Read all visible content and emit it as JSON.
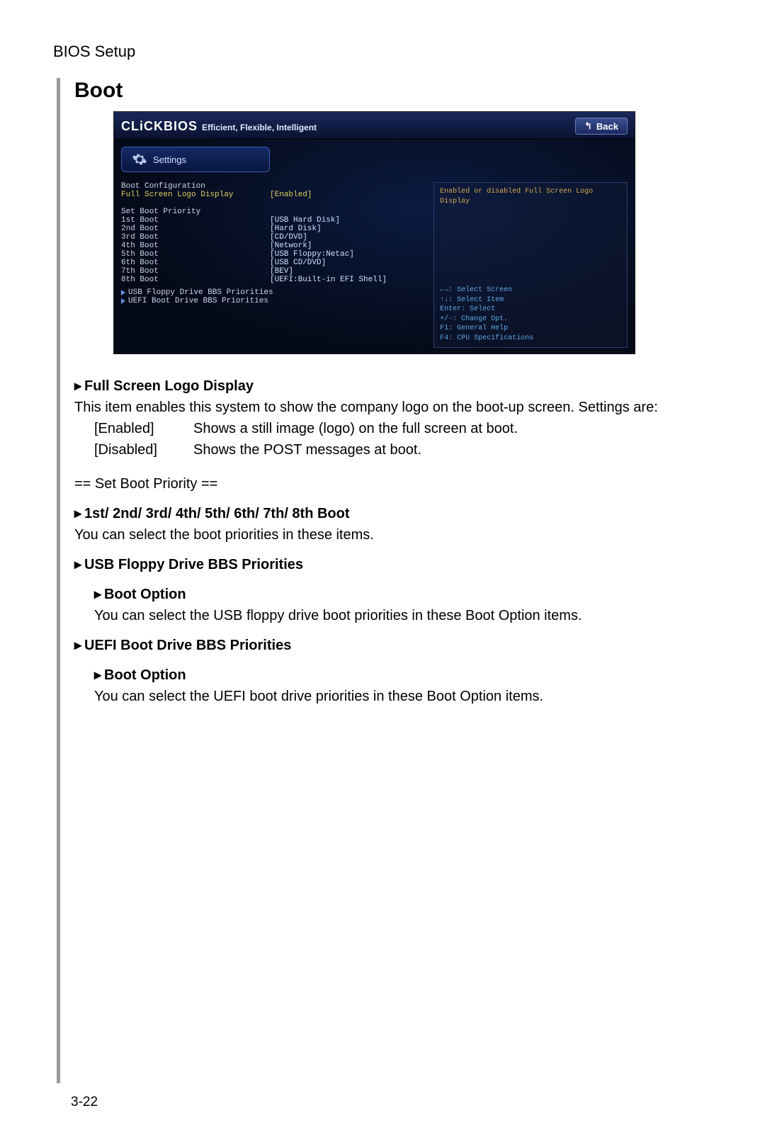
{
  "header": {
    "title": "BIOS Setup"
  },
  "section_title": "Boot",
  "bios": {
    "logo": "CLiCKBIOS",
    "tagline": "Efficient, Flexible, Intelligent",
    "back": "Back",
    "settings_label": "Settings",
    "left": {
      "boot_configuration": "Boot Configuration",
      "full_screen_logo": {
        "label": "Full Screen Logo Display",
        "value": "[Enabled]"
      },
      "set_boot_priority": "Set Boot Priority",
      "boots": [
        {
          "label": "1st Boot",
          "value": "[USB Hard Disk]"
        },
        {
          "label": "2nd Boot",
          "value": "[Hard Disk]"
        },
        {
          "label": "3rd Boot",
          "value": "[CD/DVD]"
        },
        {
          "label": "4th Boot",
          "value": "[Network]"
        },
        {
          "label": "5th Boot",
          "value": "[USB Floppy:Netac]"
        },
        {
          "label": "6th Boot",
          "value": "[USB CD/DVD]"
        },
        {
          "label": "7th Boot",
          "value": "[BEV]"
        },
        {
          "label": "8th Boot",
          "value": "[UEFI:Built-in EFI Shell]"
        }
      ],
      "sub1": "USB Floppy Drive BBS Priorities",
      "sub2": "UEFI Boot Drive BBS Priorities"
    },
    "right": {
      "help": "Enabled or disabled Full Screen Logo Display",
      "keys": [
        "←→: Select Screen",
        "↑↓: Select Item",
        "Enter: Select",
        "+/-: Change Opt.",
        "F1: General Help",
        "F4: CPU Specifications"
      ]
    }
  },
  "doc": {
    "item1": {
      "head": "Full Screen Logo Display",
      "desc": "This item enables this system to show the company logo on the boot-up screen. Settings are:",
      "opt1k": "[Enabled]",
      "opt1v": "Shows a still image (logo) on the full screen at boot.",
      "opt2k": "[Disabled]",
      "opt2v": "Shows the POST messages at boot."
    },
    "set_boot": "== Set Boot Priority ==",
    "item2": {
      "head": "1st/ 2nd/ 3rd/ 4th/ 5th/ 6th/ 7th/ 8th Boot",
      "desc": "You can select the boot priorities in these items."
    },
    "item3": {
      "head": "USB Floppy Drive BBS Priorities",
      "subhead": "Boot Option",
      "desc": "You can select the USB floppy drive boot priorities in these Boot Option items."
    },
    "item4": {
      "head": "UEFI Boot Drive BBS Priorities",
      "subhead": "Boot Option",
      "desc": "You can select the UEFI boot drive priorities in these Boot Option items."
    }
  },
  "page_number": "3-22"
}
